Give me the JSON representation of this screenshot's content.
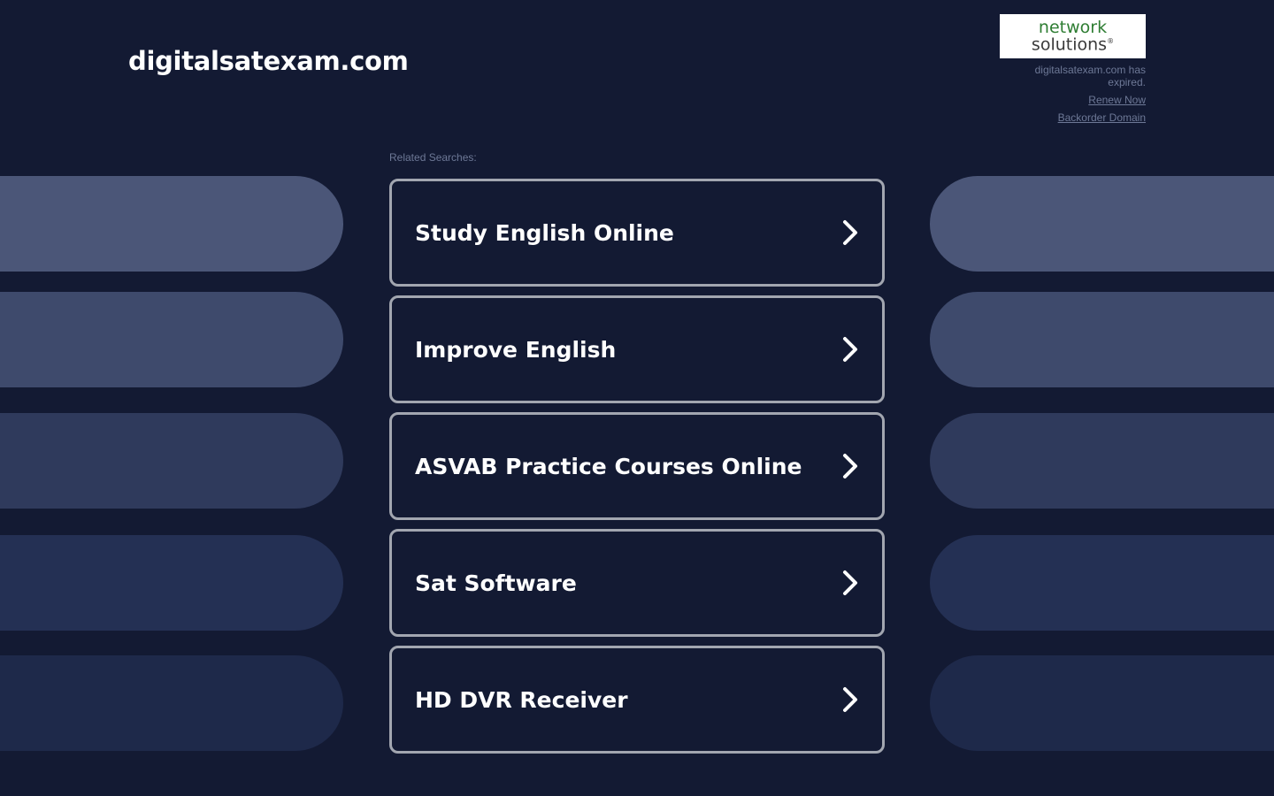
{
  "header": {
    "domain": "digitalsatexam.com"
  },
  "registrar": {
    "logo_line1": "network",
    "logo_line2": "solutions",
    "logo_mark": "®",
    "expired_text": "digitalsatexam.com has expired.",
    "renew_label": "Renew Now",
    "backorder_label": "Backorder Domain"
  },
  "related": {
    "label": "Related Searches:",
    "items": [
      {
        "label": "Study English Online",
        "icon": "chevron-right-icon"
      },
      {
        "label": "Improve English",
        "icon": "chevron-right-icon"
      },
      {
        "label": "ASVAB Practice Courses Online",
        "icon": "chevron-right-icon"
      },
      {
        "label": "Sat Software",
        "icon": "chevron-right-icon"
      },
      {
        "label": "HD DVR Receiver",
        "icon": "chevron-right-icon"
      }
    ]
  },
  "colors": {
    "background": "#131a33",
    "card_border": "#a2a6b0",
    "pill_shades": [
      "#4b5678",
      "#3e4a6c",
      "#2f3a5c",
      "#243054",
      "#1e294a"
    ],
    "logo_green": "#2e7d32"
  }
}
